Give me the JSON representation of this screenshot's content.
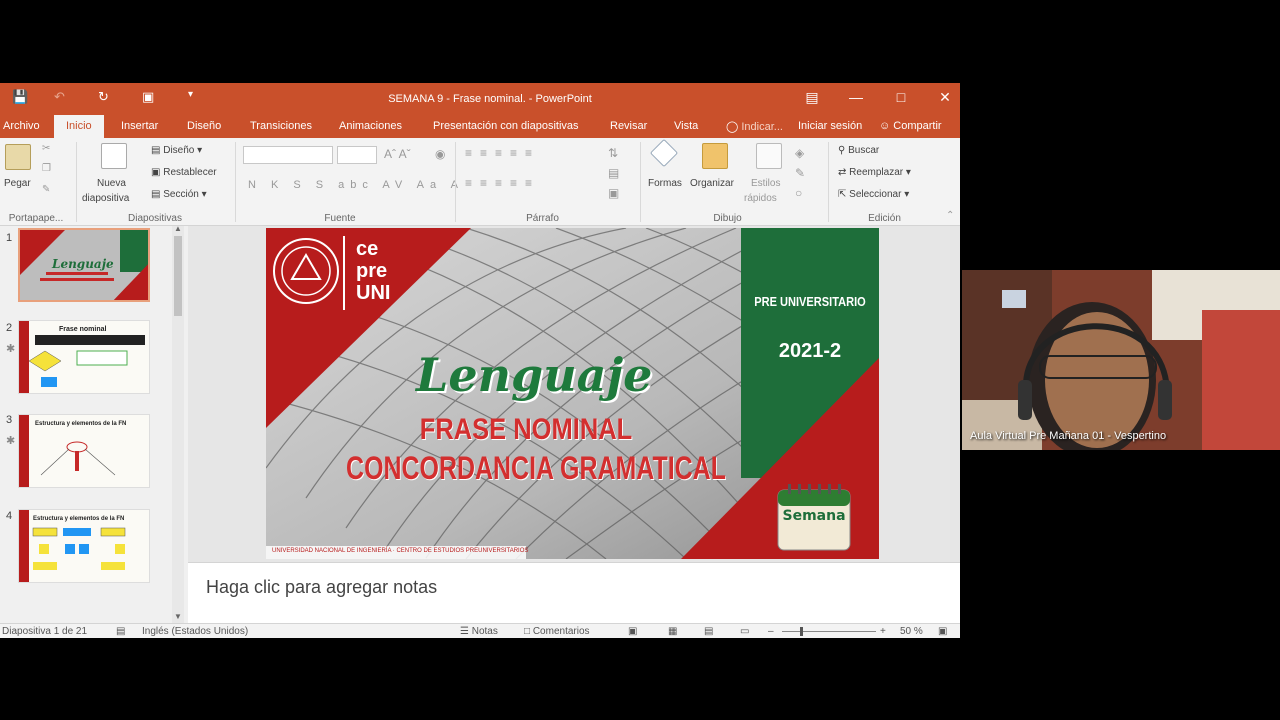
{
  "window": {
    "title": "SEMANA 9 - Frase nominal. - PowerPoint",
    "accent": "#c9502b"
  },
  "tabs": {
    "archivo": "Archivo",
    "inicio": "Inicio",
    "insertar": "Insertar",
    "diseno": "Diseño",
    "transiciones": "Transiciones",
    "animaciones": "Animaciones",
    "presentacion": "Presentación con diapositivas",
    "revisar": "Revisar",
    "vista": "Vista",
    "indicar": "Indicar...",
    "iniciar_sesion": "Iniciar sesión",
    "compartir": "Compartir"
  },
  "ribbon": {
    "pegar": "Pegar",
    "portapapeles": "Portapape...",
    "nueva_line1": "Nueva",
    "nueva_line2": "diapositiva",
    "diseno": "Diseño",
    "restablecer": "Restablecer",
    "seccion": "Sección",
    "diapositivas": "Diapositivas",
    "fuente": "Fuente",
    "parrafo": "Párrafo",
    "formas": "Formas",
    "organizar": "Organizar",
    "estilos_line1": "Estilos",
    "estilos_line2": "rápidos",
    "dibujo": "Dibujo",
    "buscar": "Buscar",
    "reemplazar": "Reemplazar",
    "seleccionar": "Seleccionar",
    "edicion": "Edición",
    "font_buttons": "N K S S abc AV Aa A"
  },
  "thumbnails": [
    {
      "num": "1",
      "title": "Lenguaje"
    },
    {
      "num": "2",
      "title": "Frase nominal"
    },
    {
      "num": "3",
      "title": "Estructura y elementos de la FN"
    },
    {
      "num": "4",
      "title": "Estructura y elementos de la FN"
    }
  ],
  "slide": {
    "logo_text": [
      "ce",
      "pre",
      "UNI"
    ],
    "title": "Lenguaje",
    "line1": "FRASE NOMINAL",
    "line2": "CONCORDANCIA GRAMATICAL",
    "cycle": "PRE UNIVERSITARIO",
    "year": "2021-2",
    "calendar": "Semana",
    "footer": "UNIVERSIDAD NACIONAL DE INGENIERÍA · CENTRO DE ESTUDIOS PREUNIVERSITARIOS",
    "colors": {
      "red": "#b71c1c",
      "green": "#1e6e3a"
    }
  },
  "notes_placeholder": "Haga clic para agregar notas",
  "status": {
    "slide": "Diapositiva 1 de 21",
    "language": "Inglés (Estados Unidos)",
    "notas": "Notas",
    "comentarios": "Comentarios",
    "zoom": "50 %"
  },
  "webcam": {
    "caption": "Aula Virtual Pre Mañana 01 - Vespertino"
  }
}
